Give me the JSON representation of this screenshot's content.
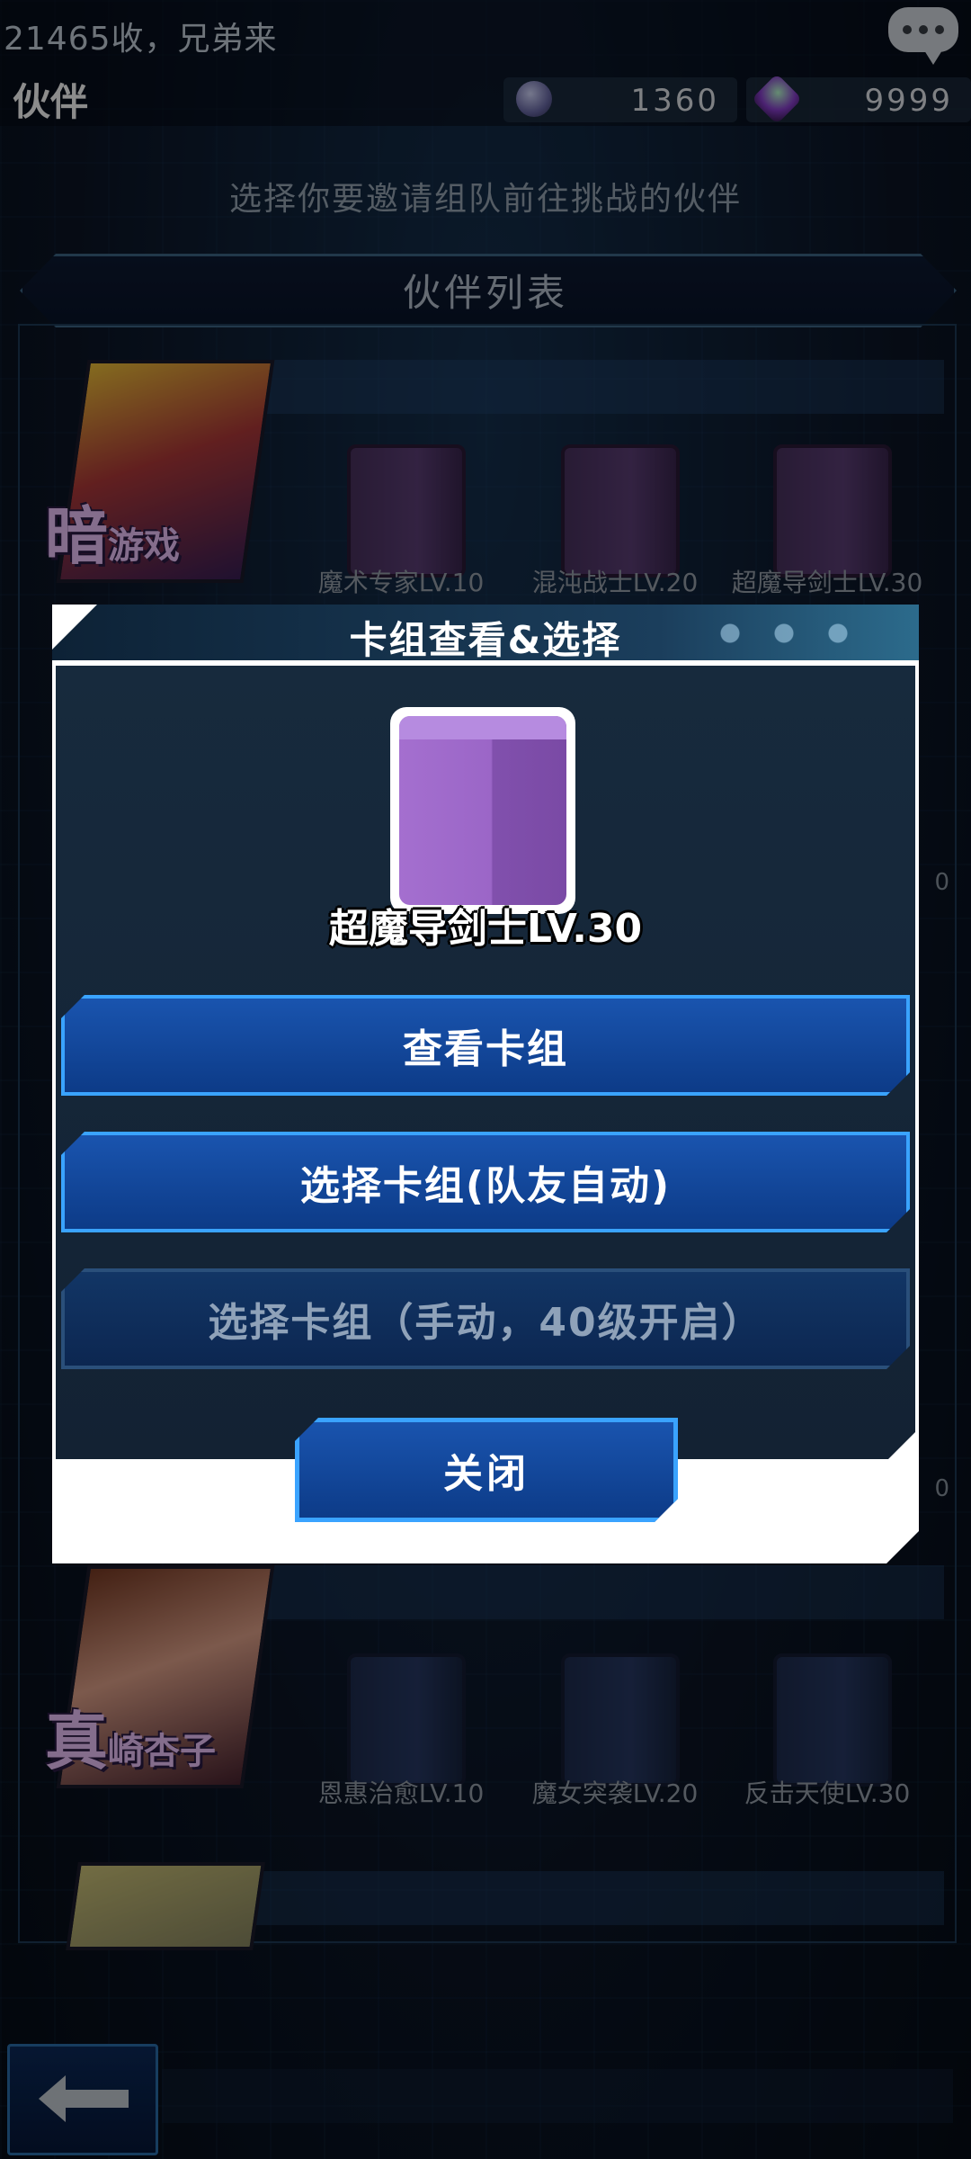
{
  "top_bar": {
    "message": "21465收，兄弟来",
    "page_title": "伙伴",
    "currency_1": "1360",
    "currency_2": "9999"
  },
  "subtitle": "选择你要邀请组队前往挑战的伙伴",
  "list_header": "伙伴列表",
  "partners": [
    {
      "name_big": "暗",
      "name_small": "游戏",
      "decks": [
        "魔术专家LV.10",
        "混沌战士LV.20",
        "超魔导剑士LV.30"
      ]
    },
    {
      "name_big": "真",
      "name_small": "崎杏子",
      "decks": [
        "恩惠治愈LV.10",
        "魔女突袭LV.20",
        "反击天使LV.30"
      ]
    }
  ],
  "partial_right_labels": [
    "0",
    "0"
  ],
  "dialog": {
    "title": "卡组查看&选择",
    "selected_deck_name": "超魔导剑士LV.30",
    "buttons": {
      "view_deck": "查看卡组",
      "select_auto": "选择卡组(队友自动)",
      "select_manual": "选择卡组（手动，40级开启）"
    },
    "close": "关闭"
  },
  "colors": {
    "accent_blue": "#1a55b0",
    "button_border": "#3aa3ff",
    "deck_purple": "#9b66c7"
  }
}
